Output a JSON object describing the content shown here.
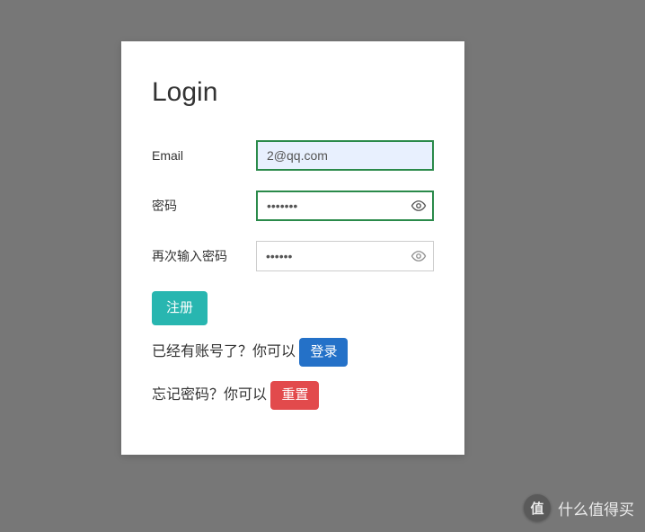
{
  "card": {
    "title": "Login"
  },
  "form": {
    "email": {
      "label": "Email",
      "value": "2@qq.com"
    },
    "password": {
      "label": "密码",
      "value": "•••••••"
    },
    "confirm_password": {
      "label": "再次输入密码",
      "value": "••••••"
    }
  },
  "actions": {
    "register": "注册",
    "login_prompt": "已经有账号了？你可以 ",
    "login_button": "登录",
    "reset_prompt": "忘记密码？你可以 ",
    "reset_button": "重置"
  },
  "watermark": {
    "badge": "值",
    "text": "什么值得买"
  }
}
